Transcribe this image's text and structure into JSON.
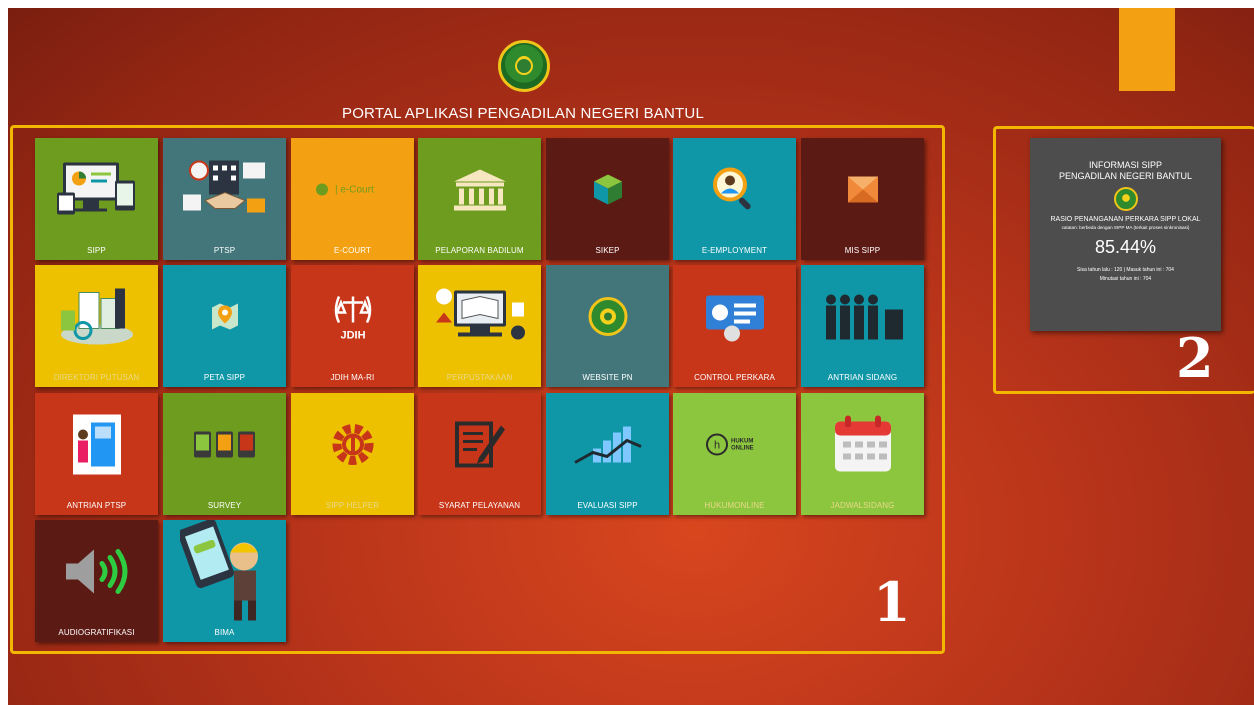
{
  "portal": {
    "title": "PORTAL APLIKASI PENGADILAN NEGERI BANTUL"
  },
  "colors": {
    "background_red": "#b8341a",
    "frame_yellow": "#f2b700",
    "accent_orange": "#f3a012",
    "info_panel": "#4d4d4d"
  },
  "tiles": [
    {
      "label": "SIPP",
      "icon": "computer-dashboard-icon",
      "color": "#6e9c1e"
    },
    {
      "label": "PTSP",
      "icon": "office-handshake-icon",
      "color": "#42767a"
    },
    {
      "label": "E-COURT",
      "icon": "e-court-logo-icon",
      "color": "#f3a012"
    },
    {
      "label": "PELAPORAN BADILUM",
      "icon": "courthouse-icon",
      "color": "#6e9c1e"
    },
    {
      "label": "SIKEP",
      "icon": "cube-icon",
      "color": "#5c1a14"
    },
    {
      "label": "E-EMPLOYMENT",
      "icon": "person-magnifier-icon",
      "color": "#0f97a7"
    },
    {
      "label": "MIS SIPP",
      "icon": "envelope-icon",
      "color": "#5c1a14"
    },
    {
      "label": "DIREKTORI PUTUSAN",
      "icon": "documents-search-icon",
      "color": "#edc000"
    },
    {
      "label": "PETA SIPP",
      "icon": "map-pin-icon",
      "color": "#0f97a7"
    },
    {
      "label": "JDIH MA-RI",
      "icon": "scales-of-justice-icon",
      "color": "#c8361a"
    },
    {
      "label": "PERPUSTAKAAN",
      "icon": "library-icon",
      "color": "#edc000"
    },
    {
      "label": "WEBSITE PN",
      "icon": "court-seal-icon",
      "color": "#42767a"
    },
    {
      "label": "CONTROL PERKARA",
      "icon": "control-panel-icon",
      "color": "#c8361a"
    },
    {
      "label": "ANTRIAN SIDANG",
      "icon": "queue-people-icon",
      "color": "#0f97a7"
    },
    {
      "label": "ANTRIAN PTSP",
      "icon": "queue-machine-icon",
      "color": "#c8361a"
    },
    {
      "label": "SURVEY",
      "icon": "survey-phones-icon",
      "color": "#6e9c1e"
    },
    {
      "label": "SIPP HELPER",
      "icon": "gear-wrench-icon",
      "color": "#edc000"
    },
    {
      "label": "SYARAT PELAYANAN",
      "icon": "document-pen-icon",
      "color": "#c8361a"
    },
    {
      "label": "EVALUASI SIPP",
      "icon": "growth-chart-icon",
      "color": "#0f97a7"
    },
    {
      "label": "HUKUMONLINE",
      "icon": "hukumonline-logo-icon",
      "color": "#8cc63f"
    },
    {
      "label": "JADWALSIDANG",
      "icon": "calendar-icon",
      "color": "#8cc63f"
    },
    {
      "label": "AUDIOGRATIFIKASI",
      "icon": "speaker-icon",
      "color": "#5c1a14"
    },
    {
      "label": "BIMA",
      "icon": "mascot-phone-icon",
      "color": "#0f97a7"
    }
  ],
  "info_panel": {
    "title_line1": "INFORMASI SIPP",
    "title_line2": "PENGADILAN NEGERI BANTUL",
    "ratio_title": "RASIO PENANGANAN PERKARA SIPP LOKAL",
    "note": "catatan: berbeda dengan SIPP MA (terkait proses sinkronisasi)",
    "percentage": "85.44%",
    "stats_line1": "Sisa tahun lalu : 120 | Masuk tahun ini : 704",
    "stats_line2": "Minutasi tahun ini : 704"
  },
  "annotations": {
    "marker1": "1",
    "marker2": "2"
  }
}
